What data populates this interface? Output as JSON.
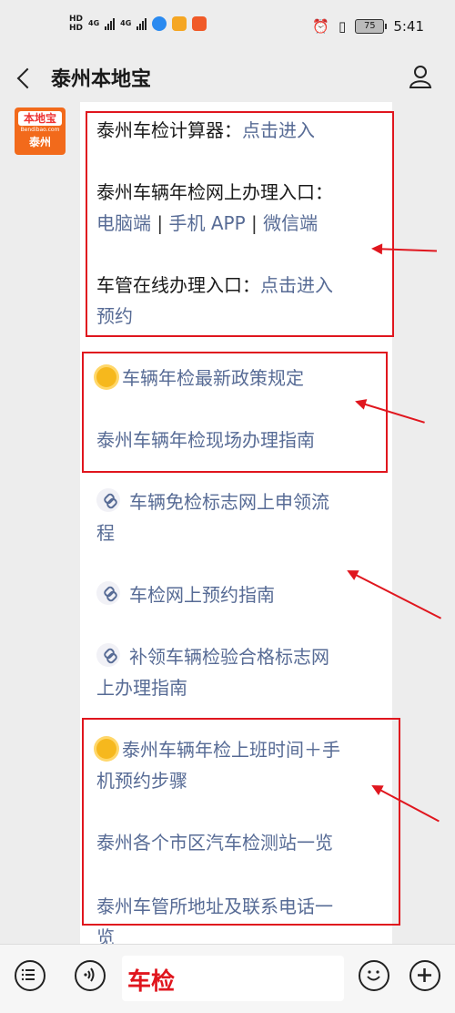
{
  "status_bar": {
    "left_labels": [
      "HD",
      "HD",
      "4G",
      "4G"
    ],
    "battery": "75",
    "time": "5:41"
  },
  "header": {
    "back_icon": "chevron-left-icon",
    "title": "泰州本地宝",
    "profile_icon": "user-icon"
  },
  "avatar": {
    "brand": "本地宝",
    "domain": "Bendibao.com",
    "city": "泰州"
  },
  "message": {
    "calc_label": "泰州车检计算器：",
    "calc_link": "点击进入",
    "online_label": "泰州车辆年检网上办理入口：",
    "online_links": [
      "电脑端",
      "手机 APP",
      "微信端"
    ],
    "separator": "|",
    "dmv_label": "车管在线办理入口：",
    "dmv_link_1": "点击进入",
    "dmv_link_2": "预约",
    "policy_link": "车辆年检最新政策规定",
    "onsite_link": "泰州车辆年检现场办理指南",
    "exempt_link_1": "车辆免检标志网上申领流",
    "exempt_link_2": "程",
    "appoint_link": "车检网上预约指南",
    "reissue_link_1": "补领车辆检验合格标志网",
    "reissue_link_2": "上办理指南",
    "hours_link_1": "泰州车辆年检上班时间＋手",
    "hours_link_2": "机预约步骤",
    "stations_link": "泰州各个市区汽车检测站一览",
    "office_link_1": "泰州车管所地址及联系电话一",
    "office_link_2": "览"
  },
  "bottom_bar": {
    "menu_icon": "menu-list-icon",
    "voice_icon": "voice-icon",
    "input_value": "车检",
    "emoji_icon": "emoji-icon",
    "plus_icon": "plus-icon"
  },
  "colors": {
    "link": "#576b95",
    "annotation_red": "#e0161e",
    "brand_orange": "#f26a1b"
  }
}
